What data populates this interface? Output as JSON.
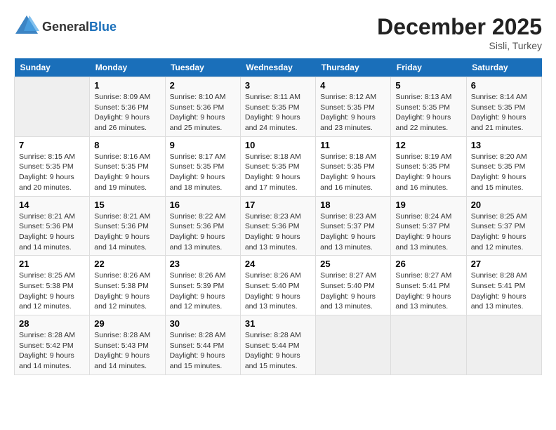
{
  "header": {
    "logo_line1": "General",
    "logo_line2": "Blue",
    "month_title": "December 2025",
    "location": "Sisli, Turkey"
  },
  "days_of_week": [
    "Sunday",
    "Monday",
    "Tuesday",
    "Wednesday",
    "Thursday",
    "Friday",
    "Saturday"
  ],
  "weeks": [
    [
      {
        "day": "",
        "sunrise": "",
        "sunset": "",
        "daylight": ""
      },
      {
        "day": "1",
        "sunrise": "Sunrise: 8:09 AM",
        "sunset": "Sunset: 5:36 PM",
        "daylight": "Daylight: 9 hours and 26 minutes."
      },
      {
        "day": "2",
        "sunrise": "Sunrise: 8:10 AM",
        "sunset": "Sunset: 5:36 PM",
        "daylight": "Daylight: 9 hours and 25 minutes."
      },
      {
        "day": "3",
        "sunrise": "Sunrise: 8:11 AM",
        "sunset": "Sunset: 5:35 PM",
        "daylight": "Daylight: 9 hours and 24 minutes."
      },
      {
        "day": "4",
        "sunrise": "Sunrise: 8:12 AM",
        "sunset": "Sunset: 5:35 PM",
        "daylight": "Daylight: 9 hours and 23 minutes."
      },
      {
        "day": "5",
        "sunrise": "Sunrise: 8:13 AM",
        "sunset": "Sunset: 5:35 PM",
        "daylight": "Daylight: 9 hours and 22 minutes."
      },
      {
        "day": "6",
        "sunrise": "Sunrise: 8:14 AM",
        "sunset": "Sunset: 5:35 PM",
        "daylight": "Daylight: 9 hours and 21 minutes."
      }
    ],
    [
      {
        "day": "7",
        "sunrise": "Sunrise: 8:15 AM",
        "sunset": "Sunset: 5:35 PM",
        "daylight": "Daylight: 9 hours and 20 minutes."
      },
      {
        "day": "8",
        "sunrise": "Sunrise: 8:16 AM",
        "sunset": "Sunset: 5:35 PM",
        "daylight": "Daylight: 9 hours and 19 minutes."
      },
      {
        "day": "9",
        "sunrise": "Sunrise: 8:17 AM",
        "sunset": "Sunset: 5:35 PM",
        "daylight": "Daylight: 9 hours and 18 minutes."
      },
      {
        "day": "10",
        "sunrise": "Sunrise: 8:18 AM",
        "sunset": "Sunset: 5:35 PM",
        "daylight": "Daylight: 9 hours and 17 minutes."
      },
      {
        "day": "11",
        "sunrise": "Sunrise: 8:18 AM",
        "sunset": "Sunset: 5:35 PM",
        "daylight": "Daylight: 9 hours and 16 minutes."
      },
      {
        "day": "12",
        "sunrise": "Sunrise: 8:19 AM",
        "sunset": "Sunset: 5:35 PM",
        "daylight": "Daylight: 9 hours and 16 minutes."
      },
      {
        "day": "13",
        "sunrise": "Sunrise: 8:20 AM",
        "sunset": "Sunset: 5:35 PM",
        "daylight": "Daylight: 9 hours and 15 minutes."
      }
    ],
    [
      {
        "day": "14",
        "sunrise": "Sunrise: 8:21 AM",
        "sunset": "Sunset: 5:36 PM",
        "daylight": "Daylight: 9 hours and 14 minutes."
      },
      {
        "day": "15",
        "sunrise": "Sunrise: 8:21 AM",
        "sunset": "Sunset: 5:36 PM",
        "daylight": "Daylight: 9 hours and 14 minutes."
      },
      {
        "day": "16",
        "sunrise": "Sunrise: 8:22 AM",
        "sunset": "Sunset: 5:36 PM",
        "daylight": "Daylight: 9 hours and 13 minutes."
      },
      {
        "day": "17",
        "sunrise": "Sunrise: 8:23 AM",
        "sunset": "Sunset: 5:36 PM",
        "daylight": "Daylight: 9 hours and 13 minutes."
      },
      {
        "day": "18",
        "sunrise": "Sunrise: 8:23 AM",
        "sunset": "Sunset: 5:37 PM",
        "daylight": "Daylight: 9 hours and 13 minutes."
      },
      {
        "day": "19",
        "sunrise": "Sunrise: 8:24 AM",
        "sunset": "Sunset: 5:37 PM",
        "daylight": "Daylight: 9 hours and 13 minutes."
      },
      {
        "day": "20",
        "sunrise": "Sunrise: 8:25 AM",
        "sunset": "Sunset: 5:37 PM",
        "daylight": "Daylight: 9 hours and 12 minutes."
      }
    ],
    [
      {
        "day": "21",
        "sunrise": "Sunrise: 8:25 AM",
        "sunset": "Sunset: 5:38 PM",
        "daylight": "Daylight: 9 hours and 12 minutes."
      },
      {
        "day": "22",
        "sunrise": "Sunrise: 8:26 AM",
        "sunset": "Sunset: 5:38 PM",
        "daylight": "Daylight: 9 hours and 12 minutes."
      },
      {
        "day": "23",
        "sunrise": "Sunrise: 8:26 AM",
        "sunset": "Sunset: 5:39 PM",
        "daylight": "Daylight: 9 hours and 12 minutes."
      },
      {
        "day": "24",
        "sunrise": "Sunrise: 8:26 AM",
        "sunset": "Sunset: 5:40 PM",
        "daylight": "Daylight: 9 hours and 13 minutes."
      },
      {
        "day": "25",
        "sunrise": "Sunrise: 8:27 AM",
        "sunset": "Sunset: 5:40 PM",
        "daylight": "Daylight: 9 hours and 13 minutes."
      },
      {
        "day": "26",
        "sunrise": "Sunrise: 8:27 AM",
        "sunset": "Sunset: 5:41 PM",
        "daylight": "Daylight: 9 hours and 13 minutes."
      },
      {
        "day": "27",
        "sunrise": "Sunrise: 8:28 AM",
        "sunset": "Sunset: 5:41 PM",
        "daylight": "Daylight: 9 hours and 13 minutes."
      }
    ],
    [
      {
        "day": "28",
        "sunrise": "Sunrise: 8:28 AM",
        "sunset": "Sunset: 5:42 PM",
        "daylight": "Daylight: 9 hours and 14 minutes."
      },
      {
        "day": "29",
        "sunrise": "Sunrise: 8:28 AM",
        "sunset": "Sunset: 5:43 PM",
        "daylight": "Daylight: 9 hours and 14 minutes."
      },
      {
        "day": "30",
        "sunrise": "Sunrise: 8:28 AM",
        "sunset": "Sunset: 5:44 PM",
        "daylight": "Daylight: 9 hours and 15 minutes."
      },
      {
        "day": "31",
        "sunrise": "Sunrise: 8:28 AM",
        "sunset": "Sunset: 5:44 PM",
        "daylight": "Daylight: 9 hours and 15 minutes."
      },
      {
        "day": "",
        "sunrise": "",
        "sunset": "",
        "daylight": ""
      },
      {
        "day": "",
        "sunrise": "",
        "sunset": "",
        "daylight": ""
      },
      {
        "day": "",
        "sunrise": "",
        "sunset": "",
        "daylight": ""
      }
    ]
  ]
}
